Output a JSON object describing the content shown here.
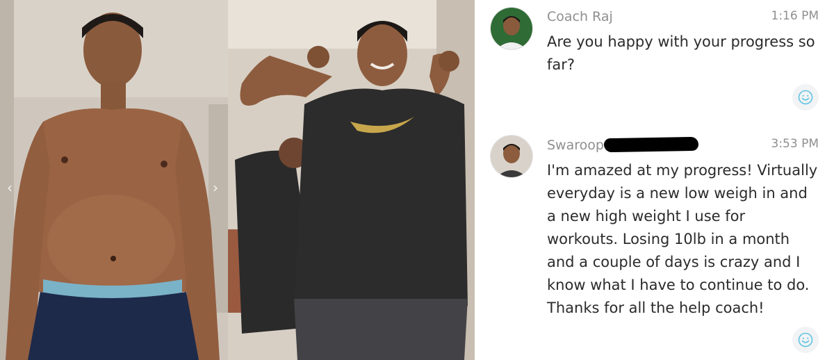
{
  "photos": {
    "before": {
      "icon": "photo-before"
    },
    "after": {
      "icon": "photo-after"
    },
    "nav": {
      "prev_glyph": "‹",
      "next_glyph": "›"
    }
  },
  "chat": {
    "messages": [
      {
        "sender": "Coach Raj",
        "time": "1:16 PM",
        "text": "Are you happy with your progress so far?",
        "avatar": "avatar-coach-raj",
        "reaction_icon": "smiley-icon"
      },
      {
        "sender": "Swaroop B",
        "time": "3:53 PM",
        "text": "I'm amazed at my progress! Virtually everyday is a new low weigh in and a new high weight I use for workouts. Losing 10lb in a month and a couple of days is crazy and I know what I have to continue to do. Thanks for all the help coach!",
        "avatar": "avatar-swaroop",
        "reaction_icon": "smiley-icon"
      }
    ]
  },
  "colors": {
    "meta_text": "#8f8f8f",
    "body_text": "#2b2b2b",
    "reaction_bg": "#f1f3f5",
    "reaction_icon": "#5fc3e0"
  }
}
